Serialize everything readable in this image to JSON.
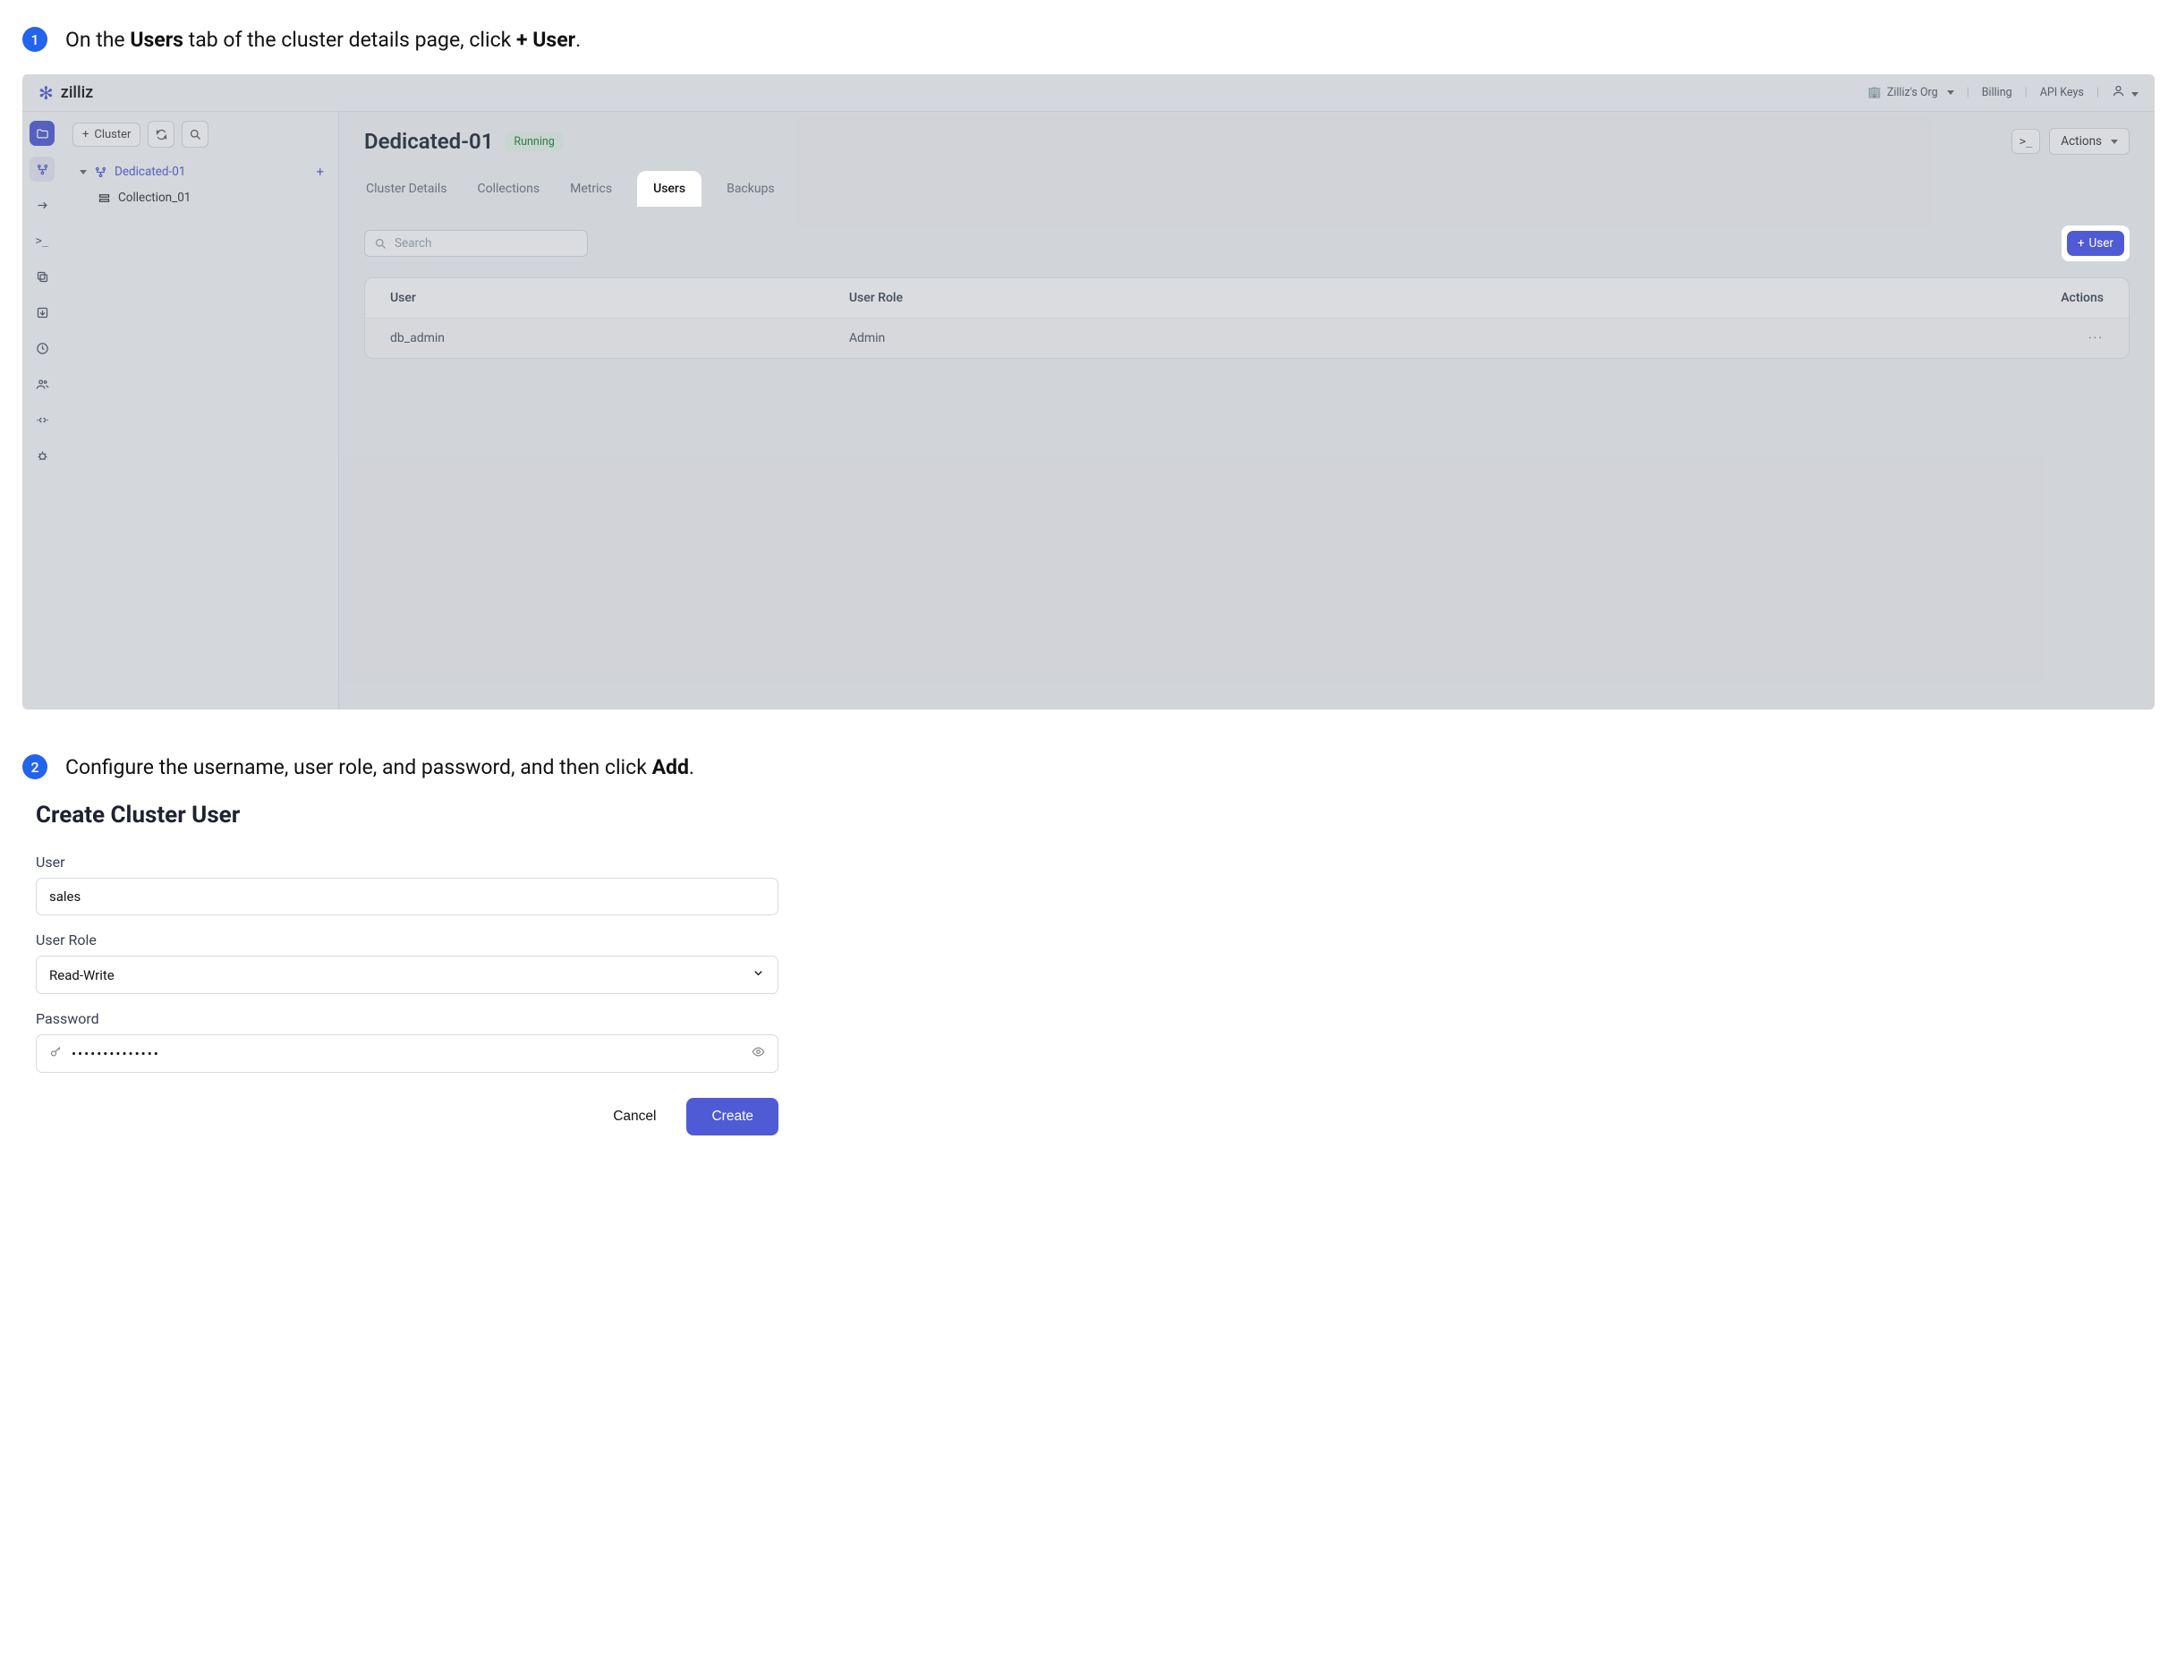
{
  "step1": {
    "number": "1",
    "text_pre": "On the ",
    "bold1": "Users",
    "text_mid": " tab of the cluster details page, click ",
    "bold2": "+ User",
    "text_post": "."
  },
  "step2": {
    "number": "2",
    "text_pre": "Configure the username, user role, and password, and then click ",
    "bold1": "Add",
    "text_post": "."
  },
  "app": {
    "brand": "zilliz",
    "topbar": {
      "org": "Zilliz's Org",
      "billing": "Billing",
      "apikeys": "API Keys"
    },
    "tree": {
      "add_cluster_label": "Cluster",
      "cluster_name": "Dedicated-01",
      "collection_name": "Collection_01"
    },
    "page": {
      "title": "Dedicated-01",
      "status": "Running",
      "actions_label": "Actions"
    },
    "tabs": [
      "Cluster Details",
      "Collections",
      "Metrics",
      "Users",
      "Backups"
    ],
    "active_tab_index": 3,
    "search_placeholder": "Search",
    "add_user_label": "User",
    "table": {
      "cols": [
        "User",
        "User Role",
        "Actions"
      ],
      "rows": [
        {
          "user": "db_admin",
          "role": "Admin"
        }
      ]
    }
  },
  "form": {
    "title": "Create Cluster User",
    "user_label": "User",
    "user_value": "sales",
    "role_label": "User Role",
    "role_value": "Read-Write",
    "password_label": "Password",
    "password_mask": "••••••••••••••",
    "cancel": "Cancel",
    "create": "Create"
  }
}
